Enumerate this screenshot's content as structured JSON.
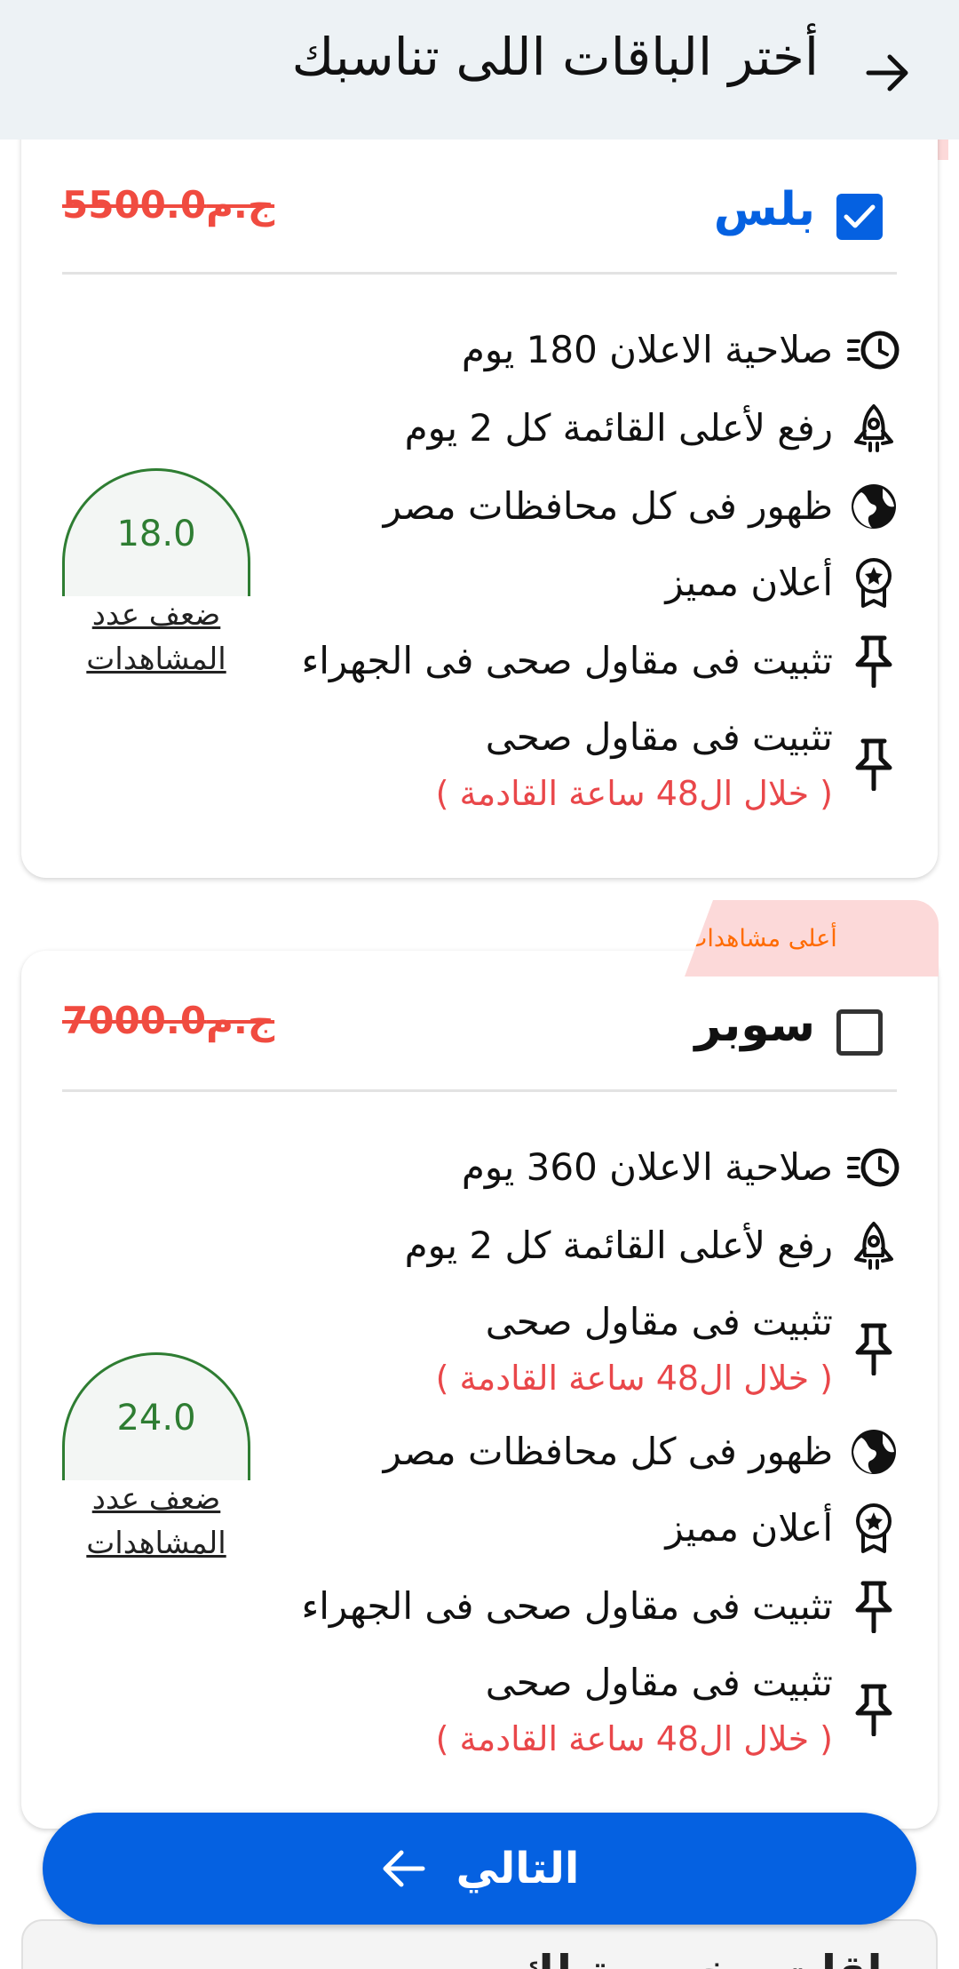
{
  "header": {
    "title": "أختر الباقات اللى تناسبك"
  },
  "packages": [
    {
      "name": "بلس",
      "price": "5500.0ج.م",
      "checked": true,
      "ribbon": "",
      "views_value": "18.0",
      "views_label": "ضعف عدد المشاهدات",
      "features": [
        {
          "icon": "clock-list-icon",
          "text": "صلاحية الاعلان 180 يوم"
        },
        {
          "icon": "rocket-icon",
          "text": "رفع لأعلى القائمة كل 2 يوم"
        },
        {
          "icon": "globe-icon",
          "text": "ظهور فى كل محافظات مصر"
        },
        {
          "icon": "award-badge-icon",
          "text": "أعلان مميز"
        },
        {
          "icon": "pin-icon",
          "text": "تثبيت فى مقاول صحى فى الجهراء"
        },
        {
          "icon": "pin-icon",
          "text": "تثبيت فى مقاول صحى",
          "note": "( خلال ال48 ساعة القادمة )"
        }
      ]
    },
    {
      "name": "سوبر",
      "price": "7000.0ج.م",
      "checked": false,
      "ribbon": "أعلى مشاهدات",
      "views_value": "24.0",
      "views_label": "ضعف عدد المشاهدات",
      "features": [
        {
          "icon": "clock-list-icon",
          "text": "صلاحية الاعلان 360 يوم"
        },
        {
          "icon": "rocket-icon",
          "text": "رفع لأعلى القائمة كل 2 يوم"
        },
        {
          "icon": "pin-icon",
          "text": "تثبيت فى مقاول صحى",
          "note": "( خلال ال48 ساعة القادمة )"
        },
        {
          "icon": "globe-icon",
          "text": "ظهور فى كل محافظات مصر"
        },
        {
          "icon": "award-badge-icon",
          "text": "أعلان مميز"
        },
        {
          "icon": "pin-icon",
          "text": "تثبيت فى مقاول صحى فى الجهراء"
        },
        {
          "icon": "pin-icon",
          "text": "تثبيت فى مقاول صحى",
          "note": "( خلال ال48 ساعة القادمة )"
        }
      ]
    }
  ],
  "next_button": {
    "label": "التالي"
  },
  "custom_packages": {
    "title": "باقات مخصصة لك"
  },
  "colors": {
    "primary": "#0561e1",
    "price": "#f04b40",
    "note": "#e9474a",
    "views": "#2e7d32",
    "ribbon_bg": "#fcd9d9",
    "ribbon_text": "#ff6b00",
    "header_bg": "#edf2f5"
  }
}
